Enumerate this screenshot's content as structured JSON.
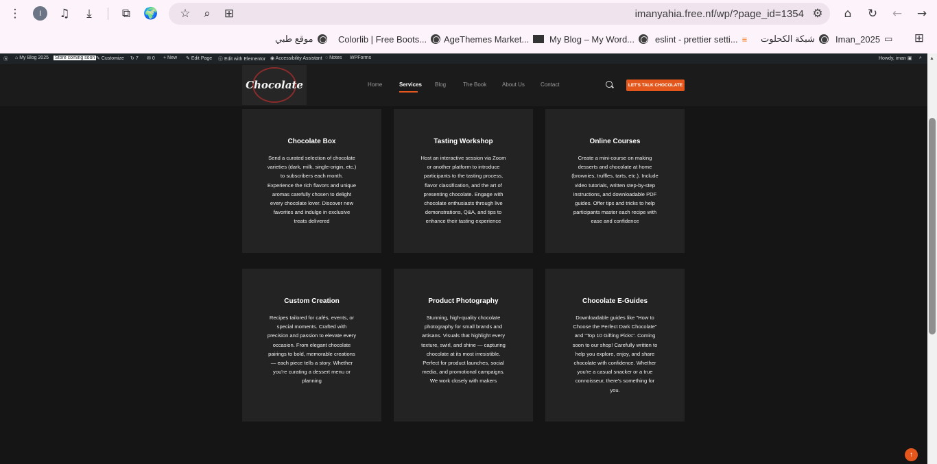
{
  "browser": {
    "profile_initial": "I",
    "url": "imanyahia.free.nf/wp/?page_id=1354",
    "bookmarks": [
      {
        "label": "موقع طبي"
      },
      {
        "label": "Colorlib | Free Boots..."
      },
      {
        "label": "AgeThemes Market..."
      },
      {
        "label": "My Blog – My Word..."
      },
      {
        "label": "eslint - prettier setti..."
      },
      {
        "label": "شبكة الكحلوت"
      },
      {
        "label": "Iman_2025"
      }
    ]
  },
  "adminbar": {
    "site": "My Blog 2025",
    "badge": "Store coming soon",
    "customize": "Customize",
    "updates": "7",
    "comments": "0",
    "new": "New",
    "edit_page": "Edit Page",
    "elementor": "Edit with Elementor",
    "accessibility": "Accessibility Assistant",
    "notes": "Notes",
    "wpforms": "WPForms",
    "howdy": "Howdy, iman"
  },
  "header": {
    "logo_text": "Chocolate",
    "nav": [
      "Home",
      "Services",
      "Blog",
      "The Book",
      "About Us",
      "Contact"
    ],
    "active_nav": "Services",
    "cta": "LET'S TALK CHOCOLATE"
  },
  "services": [
    {
      "title": "Chocolate Box",
      "text": "Send a curated selection of chocolate varieties (dark, milk, single-origin, etc.) to subscribers each month. Experience the rich flavors and unique aromas carefully chosen to delight every chocolate lover. Discover new favorites and indulge in exclusive treats delivered"
    },
    {
      "title": "Tasting Workshop",
      "text": "Host an interactive session via Zoom or another platform to introduce participants to the tasting process, flavor classification, and the art of presenting chocolate. Engage with chocolate enthusiasts through live demonstrations, Q&A, and tips to enhance their tasting experience"
    },
    {
      "title": "Online Courses",
      "text": "Create a mini-course on making desserts and chocolate at home (brownies, truffles, tarts, etc.). Include video tutorials, written step-by-step instructions, and downloadable PDF guides. Offer tips and tricks to help participants master each recipe with ease and confidence"
    },
    {
      "title": "Custom Creation",
      "text": "Recipes tailored for cafés, events, or special moments. Crafted with precision and passion to elevate every occasion. From elegant chocolate pairings to bold, memorable creations — each piece tells a story. Whether you're curating a dessert menu or planning"
    },
    {
      "title": "Product Photography",
      "text": "Stunning, high-quality chocolate photography for small brands and artisans. Visuals that highlight every texture, swirl, and shine — capturing chocolate at its most irresistible. Perfect for product launches, social media, and promotional campaigns. We work closely with makers"
    },
    {
      "title": "Chocolate E-Guides",
      "text": "Downloadable guides like \"How to Choose the Perfect Dark Chocolate\" and \"Top 10 Gifting Picks\". Coming soon to our shop! Carefully written to help you explore, enjoy, and share chocolate with confidence. Whether you're a casual snacker or a true connoisseur, there's something for you."
    }
  ],
  "colors": {
    "accent": "#e4571c",
    "card_bg": "#232323",
    "page_bg": "#151515"
  }
}
